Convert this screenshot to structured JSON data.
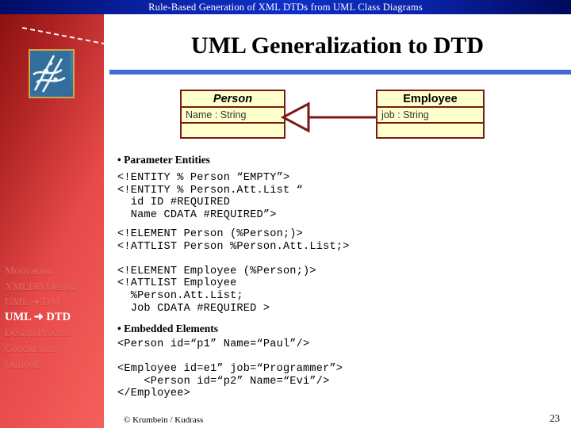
{
  "header": {
    "banner_title": "Rule-Based Generation of XML DTDs from UML Class Diagrams"
  },
  "slide": {
    "title": "UML Generalization to DTD"
  },
  "sidebar": {
    "logo_alt": "presentation-logo",
    "items": [
      {
        "label": "Motivation",
        "active": false
      },
      {
        "label": "XMLDB Design",
        "active": false
      },
      {
        "label": "UML ➜ DM",
        "active": false
      },
      {
        "label": "UML ➜ DTD",
        "active": true
      },
      {
        "label": "Design Process",
        "active": false
      },
      {
        "label": "Conclusions",
        "active": false
      },
      {
        "label": "Outlook",
        "active": false
      }
    ]
  },
  "diagram": {
    "classes": [
      {
        "name": "Person",
        "italic": true,
        "attributes": "Name : String",
        "operations": ""
      },
      {
        "name": "Employee",
        "italic": false,
        "attributes": "job : String",
        "operations": ""
      }
    ],
    "relationship": "generalization",
    "arrow_direction": "left"
  },
  "content": {
    "parameter_entities_heading": "• Parameter Entities",
    "parameter_entities_code": "<!ENTITY % Person “EMPTY”>\n<!ENTITY % Person.Att.List “\n  id ID #REQUIRED\n  Name CDATA #REQUIRED”>",
    "element_declarations_code": "<!ELEMENT Person (%Person;)>\n<!ATTLIST Person %Person.Att.List;>\n\n<!ELEMENT Employee (%Person;)>\n<!ATTLIST Employee\n  %Person.Att.List;\n  Job CDATA #REQUIRED >",
    "embedded_elements_heading": "• Embedded Elements",
    "embedded_elements_code": "<Person id=“p1” Name=“Paul”/>\n\n<Employee id=e1” job=“Programmer”>\n    <Person id=“p2” Name=“Evi”/>\n</Employee>"
  },
  "footer": {
    "copyright": "© Krumbein / Kudrass",
    "page_number": "23"
  },
  "colors": {
    "banner_blue": "#0f2fc8",
    "sidebar_red": "#e84a4a",
    "rule_blue": "#4169d8",
    "class_fill": "#ffffcc",
    "class_border": "#7b1a14",
    "nav_inactive": "#e06b63",
    "nav_active": "#ffffff"
  }
}
